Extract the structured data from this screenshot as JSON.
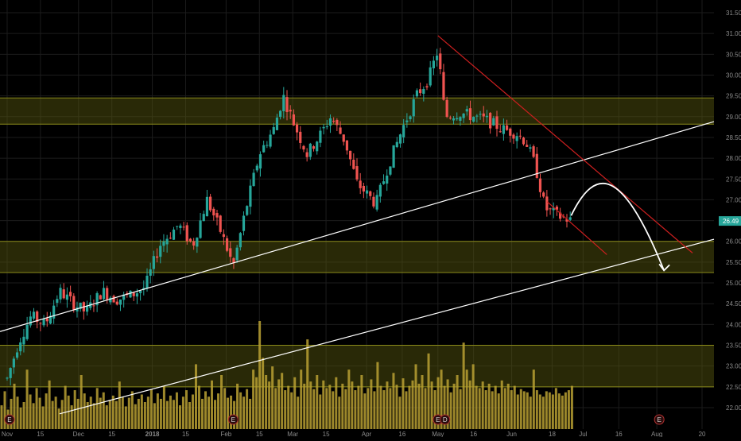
{
  "chart_data": {
    "type": "candlestick",
    "y_axis": {
      "ticks": [
        "31.50",
        "31.00",
        "30.50",
        "30.00",
        "29.50",
        "29.00",
        "28.50",
        "28.00",
        "27.50",
        "27.00",
        "26.50",
        "26.00",
        "25.50",
        "25.00",
        "24.50",
        "24.00",
        "23.50",
        "23.00",
        "22.50",
        "22.00"
      ],
      "tick_values": [
        31.5,
        31.0,
        30.5,
        30.0,
        29.5,
        29.0,
        28.5,
        28.0,
        27.5,
        27.0,
        26.5,
        26.0,
        25.5,
        25.0,
        24.5,
        24.0,
        23.5,
        23.0,
        22.5,
        22.0
      ],
      "range": [
        21.75,
        31.75
      ],
      "side": "right"
    },
    "x_axis": {
      "ticks": [
        "Nov",
        "15",
        "Dec",
        "15",
        "2018",
        "15",
        "Feb",
        "15",
        "Mar",
        "15",
        "Apr",
        "16",
        "May",
        "16",
        "Jun",
        "18",
        "Jul",
        "16",
        "Aug",
        "20"
      ],
      "bold_ticks": [
        "2018"
      ],
      "tick_days": [
        0,
        14,
        30,
        44,
        61,
        75,
        92,
        106,
        120,
        134,
        151,
        166,
        181,
        196,
        212,
        229,
        242,
        257,
        273,
        292
      ],
      "range_days": [
        -3,
        297
      ]
    },
    "last_price": {
      "label": "26.49",
      "value": 26.49,
      "color": "#26a69a"
    },
    "zones": [
      {
        "from": 28.82,
        "to": 29.45
      },
      {
        "from": 25.25,
        "to": 26.0
      },
      {
        "from": 22.5,
        "to": 23.5
      }
    ],
    "trendlines": [
      {
        "color": "#ffffff",
        "from": {
          "day": -3,
          "price": 23.83
        },
        "to": {
          "day": 297,
          "price": 28.88
        }
      },
      {
        "color": "#ffffff",
        "from": {
          "day": 22,
          "price": 21.85
        },
        "to": {
          "day": 297,
          "price": 26.05
        }
      },
      {
        "color": "#cc1f1f",
        "from": {
          "day": 181,
          "price": 30.95
        },
        "to": {
          "day": 288,
          "price": 25.72
        }
      },
      {
        "color": "#cc1f1f",
        "from": {
          "day": 227,
          "price": 26.95
        },
        "to": {
          "day": 252,
          "price": 25.68
        }
      }
    ],
    "projection_arrow": {
      "color": "#ffffff",
      "from": {
        "day": 237,
        "price": 26.62
      },
      "peak": {
        "day": 252,
        "price": 27.5
      },
      "to": {
        "day": 276,
        "price": 25.3
      }
    },
    "earnings_markers": [
      {
        "label": "E",
        "day": 1
      },
      {
        "label": "E",
        "day": 95
      },
      {
        "label": "E",
        "day": 181
      },
      {
        "label": "D",
        "day": 184
      },
      {
        "label": "E",
        "day": 274
      }
    ],
    "series": {
      "price_keypoints": [
        {
          "day": 0,
          "price": 22.7
        },
        {
          "day": 5,
          "price": 23.6
        },
        {
          "day": 10,
          "price": 24.2
        },
        {
          "day": 16,
          "price": 24.0
        },
        {
          "day": 22,
          "price": 24.8
        },
        {
          "day": 28,
          "price": 24.5
        },
        {
          "day": 33,
          "price": 24.3
        },
        {
          "day": 40,
          "price": 24.8
        },
        {
          "day": 46,
          "price": 24.6
        },
        {
          "day": 52,
          "price": 24.7
        },
        {
          "day": 58,
          "price": 24.9
        },
        {
          "day": 64,
          "price": 25.9
        },
        {
          "day": 72,
          "price": 26.4
        },
        {
          "day": 78,
          "price": 25.9
        },
        {
          "day": 84,
          "price": 27.0
        },
        {
          "day": 90,
          "price": 26.2
        },
        {
          "day": 95,
          "price": 25.4
        },
        {
          "day": 100,
          "price": 26.7
        },
        {
          "day": 106,
          "price": 28.1
        },
        {
          "day": 112,
          "price": 28.7
        },
        {
          "day": 116,
          "price": 29.5
        },
        {
          "day": 120,
          "price": 28.9
        },
        {
          "day": 126,
          "price": 28.1
        },
        {
          "day": 132,
          "price": 28.6
        },
        {
          "day": 136,
          "price": 29.0
        },
        {
          "day": 142,
          "price": 28.4
        },
        {
          "day": 147,
          "price": 27.4
        },
        {
          "day": 155,
          "price": 26.9
        },
        {
          "day": 160,
          "price": 27.8
        },
        {
          "day": 166,
          "price": 28.7
        },
        {
          "day": 172,
          "price": 29.5
        },
        {
          "day": 177,
          "price": 29.9
        },
        {
          "day": 181,
          "price": 30.6
        },
        {
          "day": 184,
          "price": 29.0
        },
        {
          "day": 190,
          "price": 29.1
        },
        {
          "day": 196,
          "price": 29.0
        },
        {
          "day": 202,
          "price": 28.9
        },
        {
          "day": 208,
          "price": 28.7
        },
        {
          "day": 214,
          "price": 28.6
        },
        {
          "day": 218,
          "price": 28.4
        },
        {
          "day": 222,
          "price": 27.8
        },
        {
          "day": 226,
          "price": 26.8
        },
        {
          "day": 232,
          "price": 26.6
        },
        {
          "day": 237,
          "price": 26.5
        }
      ],
      "volume_bars": [
        0.22,
        0.35,
        0.18,
        0.28,
        0.42,
        0.3,
        0.2,
        0.25,
        0.55,
        0.32,
        0.24,
        0.38,
        0.29,
        0.21,
        0.33,
        0.45,
        0.26,
        0.3,
        0.19,
        0.27,
        0.4,
        0.31,
        0.22,
        0.36,
        0.28,
        0.5,
        0.33,
        0.25,
        0.3,
        0.24,
        0.38,
        0.29,
        0.34,
        0.22,
        0.27,
        0.31,
        0.26,
        0.44,
        0.3,
        0.21,
        0.29,
        0.35,
        0.23,
        0.28,
        0.32,
        0.25,
        0.3,
        0.37,
        0.24,
        0.33,
        0.28,
        0.4,
        0.26,
        0.31,
        0.27,
        0.34,
        0.22,
        0.3,
        0.36,
        0.25,
        0.32,
        0.6,
        0.4,
        0.28,
        0.35,
        0.3,
        0.45,
        0.27,
        0.33,
        0.5,
        0.38,
        0.29,
        0.31,
        0.26,
        0.42,
        0.34,
        0.3,
        0.37,
        0.28,
        0.55,
        0.48,
        1.0,
        0.66,
        0.5,
        0.44,
        0.58,
        0.38,
        0.46,
        0.52,
        0.36,
        0.4,
        0.34,
        0.48,
        0.3,
        0.55,
        0.42,
        0.83,
        0.44,
        0.37,
        0.5,
        0.32,
        0.45,
        0.38,
        0.41,
        0.35,
        0.48,
        0.3,
        0.42,
        0.37,
        0.55,
        0.44,
        0.36,
        0.4,
        0.5,
        0.33,
        0.38,
        0.46,
        0.35,
        0.62,
        0.4,
        0.36,
        0.44,
        0.38,
        0.52,
        0.41,
        0.3,
        0.47,
        0.35,
        0.4,
        0.45,
        0.6,
        0.42,
        0.5,
        0.38,
        0.7,
        0.44,
        0.36,
        0.48,
        0.55,
        0.4,
        0.46,
        0.34,
        0.42,
        0.5,
        0.37,
        0.8,
        0.55,
        0.45,
        0.6,
        0.4,
        0.38,
        0.44,
        0.36,
        0.42,
        0.35,
        0.4,
        0.33,
        0.45,
        0.38,
        0.42,
        0.36,
        0.4,
        0.32,
        0.37,
        0.35,
        0.34,
        0.3,
        0.55,
        0.36,
        0.32,
        0.3,
        0.35,
        0.34,
        0.32,
        0.38,
        0.33,
        0.31,
        0.34,
        0.36,
        0.4
      ]
    }
  }
}
